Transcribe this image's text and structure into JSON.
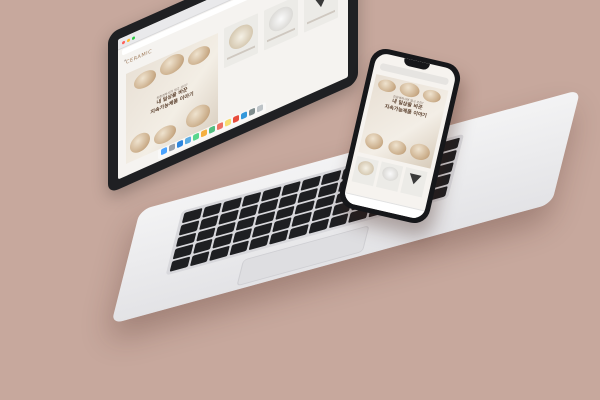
{
  "colors": {
    "background": "#c7a89d",
    "laptop_bezel": "#1f2023",
    "laptop_body": "#e9e9ec",
    "accent_brown": "#5a3f2c"
  },
  "laptop": {
    "browser": {
      "url": "",
      "traffic_lights": [
        "#ff5f57",
        "#febc2e",
        "#28c840"
      ]
    },
    "site": {
      "logo": "CERAMIC",
      "nav_links": [
        "",
        "",
        "",
        ""
      ],
      "hero": {
        "subtitle": "친환경하시려 얼고 코리?",
        "line1": "내 일상을 바꾼",
        "line2": "지속가능제품 이야기"
      },
      "products": [
        {
          "icon": "bowls-icon"
        },
        {
          "icon": "dish-icon"
        },
        {
          "icon": "triangle-icon"
        }
      ]
    },
    "dock_icons": [
      "finder-icon",
      "launchpad-icon",
      "safari-icon",
      "mail-icon",
      "maps-icon",
      "photos-icon",
      "messages-icon",
      "calendar-icon",
      "notes-icon",
      "music-icon",
      "appstore-icon",
      "settings-icon",
      "trash-icon"
    ]
  },
  "phone": {
    "status": "",
    "url": "",
    "hero": {
      "subtitle": "친환경하시려 얼고 코리?",
      "line1": "내 일상을 바꾼",
      "line2": "지속가능제품 이야기"
    },
    "products": [
      {
        "icon": "bowls-icon"
      },
      {
        "icon": "dish-icon"
      },
      {
        "icon": "triangle-icon"
      }
    ],
    "bottom_bar": ""
  }
}
